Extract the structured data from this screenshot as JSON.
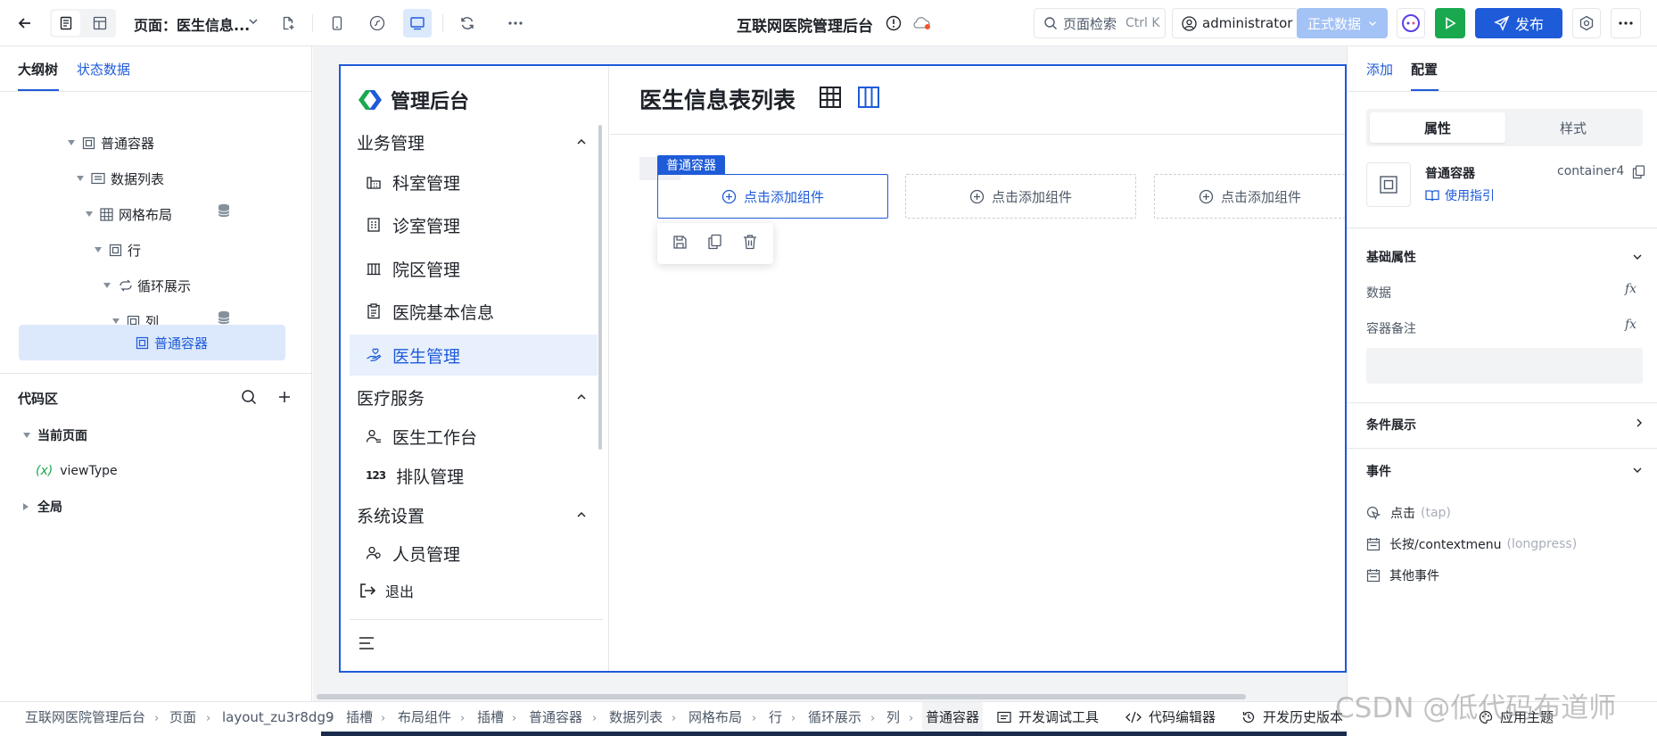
{
  "topbar": {
    "page_label": "页面：医生信息...",
    "app_title": "互联网医院管理后台",
    "search_label": "页面检索",
    "search_shortcut": "Ctrl K",
    "user": "administrator",
    "env_label": "正式数据",
    "publish_label": "发布"
  },
  "left": {
    "tabs": [
      "大纲树",
      "状态数据"
    ],
    "tree": [
      {
        "label": "普通容器"
      },
      {
        "label": "数据列表"
      },
      {
        "label": "网格布局"
      },
      {
        "label": "行"
      },
      {
        "label": "循环展示"
      },
      {
        "label": "列"
      },
      {
        "label": "普通容器"
      }
    ],
    "code_title": "代码区",
    "current_page": "当前页面",
    "var_icon": "(x)",
    "var_name": "viewType",
    "global": "全局"
  },
  "canvas": {
    "brand": "管理后台",
    "page_heading": "医生信息表列表",
    "groups": [
      {
        "label": "业务管理",
        "items": [
          "科室管理",
          "诊室管理",
          "院区管理",
          "医院基本信息",
          "医生管理"
        ]
      },
      {
        "label": "医疗服务",
        "items": [
          "医生工作台",
          "排队管理"
        ]
      },
      {
        "label": "系统设置",
        "items": [
          "人员管理"
        ]
      }
    ],
    "logout": "退出",
    "container_tag": "普通容器",
    "add_component": "点击添加组件"
  },
  "right": {
    "tabs": [
      "添加",
      "配置"
    ],
    "subtabs": [
      "属性",
      "样式"
    ],
    "component_name": "普通容器",
    "component_id": "container4",
    "guide_link": "使用指引",
    "basic_props": "基础属性",
    "data_label": "数据",
    "note_label": "容器备注",
    "fx": "fx",
    "condition_label": "条件展示",
    "events_label": "事件",
    "events": [
      {
        "name": "点击",
        "hint": "(tap)"
      },
      {
        "name": "长按/contextmenu",
        "hint": "(longpress)"
      },
      {
        "name": "其他事件",
        "hint": ""
      }
    ]
  },
  "bottom": {
    "breadcrumbs": [
      "互联网医院管理后台",
      "页面",
      "layout_zu3r8dg9",
      "插槽",
      "布局组件",
      "插槽",
      "普通容器",
      "数据列表",
      "网格布局",
      "行",
      "循环展示",
      "列",
      "普通容器"
    ],
    "tools": [
      "开发调试工具",
      "代码编辑器",
      "开发历史版本",
      "应用主题"
    ]
  },
  "watermark": "CSDN @低代码布道师",
  "colors": {
    "primary": "#1e5bd8",
    "selected_bg": "#dce8fc",
    "green": "#1aa84f",
    "disabled_blue": "#a3c2f5"
  }
}
